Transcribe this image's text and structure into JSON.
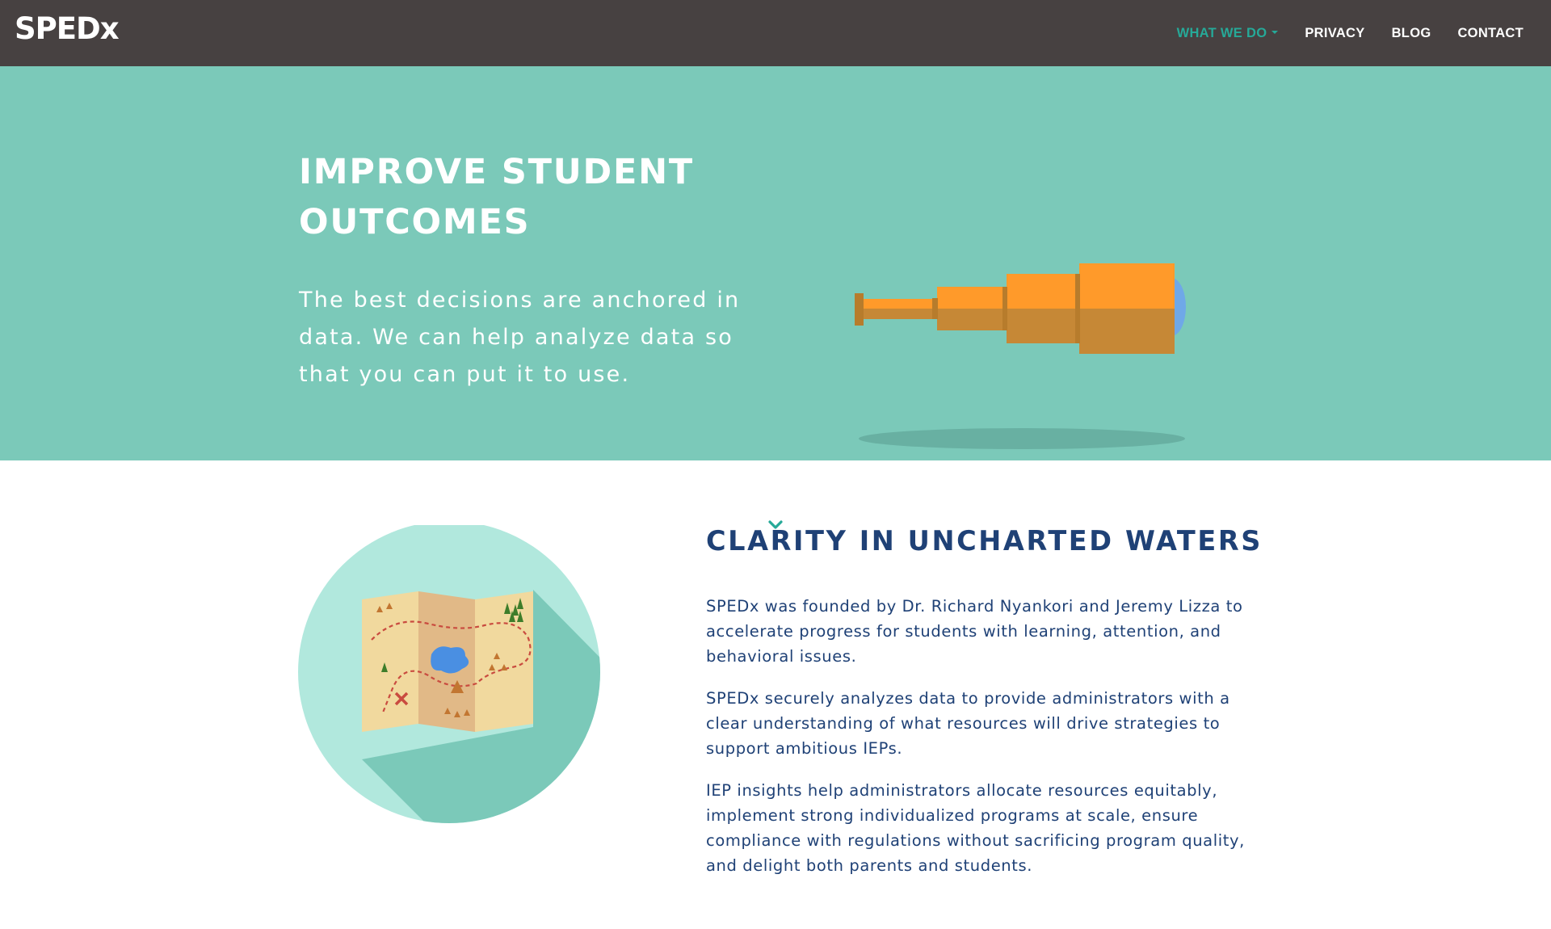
{
  "brand": {
    "logo": "SPEDx"
  },
  "nav": {
    "items": [
      {
        "label": "WHAT WE DO",
        "active": true,
        "dropdown": true
      },
      {
        "label": "PRIVACY",
        "active": false
      },
      {
        "label": "BLOG",
        "active": false
      },
      {
        "label": "CONTACT",
        "active": false
      }
    ]
  },
  "hero": {
    "title": "IMPROVE STUDENT OUTCOMES",
    "text": "The best decisions are anchored in data. We can help analyze data so that you can put it to use.",
    "illustration": "telescope-icon",
    "scroll_icon": "chevron-down-icon"
  },
  "section": {
    "title": "CLARITY IN UNCHARTED WATERS",
    "illustration": "treasure-map-icon",
    "paragraphs": [
      "SPEDx was founded by Dr. Richard Nyankori and Jeremy Lizza to accelerate progress for students with learning, attention, and behavioral issues.",
      "SPEDx securely analyzes data to provide administrators with a clear understanding of what resources will drive strategies to support ambitious IEPs.",
      "IEP insights help administrators allocate resources equitably, implement strong individualized programs at scale, ensure compliance with regulations without sacrificing program quality, and delight both parents and students."
    ]
  },
  "colors": {
    "navbar": "#474141",
    "hero_bg": "#7bc9b9",
    "accent": "#26a998",
    "heading": "#1f4176",
    "telescope_orange": "#ff9a2a",
    "telescope_shade": "#c68836"
  }
}
